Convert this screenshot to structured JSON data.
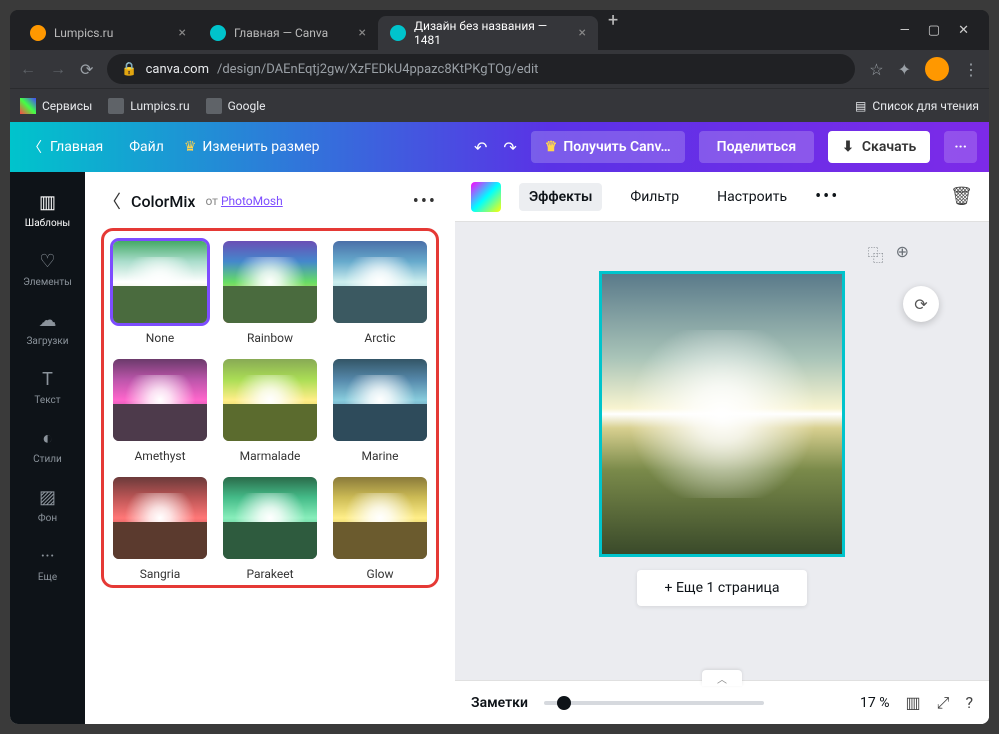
{
  "browser": {
    "tabs": [
      {
        "title": "Lumpics.ru",
        "icon": "orange"
      },
      {
        "title": "Главная — Canva",
        "icon": "canva"
      },
      {
        "title": "Дизайн без названия — 1481",
        "icon": "canva",
        "active": true
      }
    ],
    "url_host": "canva.com",
    "url_path": "/design/DAEnEqtj2gw/XzFEDkU4ppazc8KtPKgTOg/edit",
    "bookmarks": [
      {
        "label": "Сервисы"
      },
      {
        "label": "Lumpics.ru"
      },
      {
        "label": "Google"
      }
    ],
    "reading_list": "Список для чтения"
  },
  "topbar": {
    "home": "Главная",
    "file": "Файл",
    "resize": "Изменить размер",
    "get_canva": "Получить Canv…",
    "share": "Поделиться",
    "download": "Скачать"
  },
  "rail": [
    {
      "label": "Шаблоны",
      "icon": "▥"
    },
    {
      "label": "Элементы",
      "icon": "♡"
    },
    {
      "label": "Загрузки",
      "icon": "☁"
    },
    {
      "label": "Текст",
      "icon": "T"
    },
    {
      "label": "Стили",
      "icon": "◐"
    },
    {
      "label": "Фон",
      "icon": "▨"
    },
    {
      "label": "Еще",
      "icon": "···"
    }
  ],
  "panel": {
    "title": "ColorMix",
    "from": "от",
    "link": "PhotoMosh",
    "effects": [
      {
        "label": "None",
        "sky": "linear-gradient(#4a6,#adc,#fff,#cda,#586)",
        "ground": "#4a6b3e"
      },
      {
        "label": "Rainbow",
        "sky": "linear-gradient(#6a4fb5,#48c,#6d6,#fd5,#d55)",
        "ground": "#4a6b3e"
      },
      {
        "label": "Arctic",
        "sky": "linear-gradient(#4a6fa8,#6ac,#cee,#8bc,#456)",
        "ground": "#3b5961"
      },
      {
        "label": "Amethyst",
        "sky": "linear-gradient(#6b3a6b,#b5a,#f6c,#a48,#534)",
        "ground": "#4d3a4b"
      },
      {
        "label": "Marmalade",
        "sky": "linear-gradient(#8a5,#ad5,#fe8,#cb4,#673)",
        "ground": "#5b6b2e"
      },
      {
        "label": "Marine",
        "sky": "linear-gradient(#356,#58a,#8cd,#579,#345)",
        "ground": "#2e4b5b"
      },
      {
        "label": "Sangria",
        "sky": "linear-gradient(#6b3a3a,#b55,#f77,#a44,#533)",
        "ground": "#5b3a2e"
      },
      {
        "label": "Parakeet",
        "sky": "linear-gradient(#2a6b4a,#4b8,#8eb,#4a7,#254)",
        "ground": "#2e5b3e"
      },
      {
        "label": "Glow",
        "sky": "linear-gradient(#8a7a3a,#cb5,#fe8,#ba4,#654)",
        "ground": "#6b5b2e"
      }
    ]
  },
  "ctoolbar": {
    "effects": "Эффекты",
    "filter": "Фильтр",
    "adjust": "Настроить"
  },
  "stage": {
    "add_page": "+ Еще 1 страница"
  },
  "footer": {
    "notes": "Заметки",
    "zoom": "17 %"
  }
}
